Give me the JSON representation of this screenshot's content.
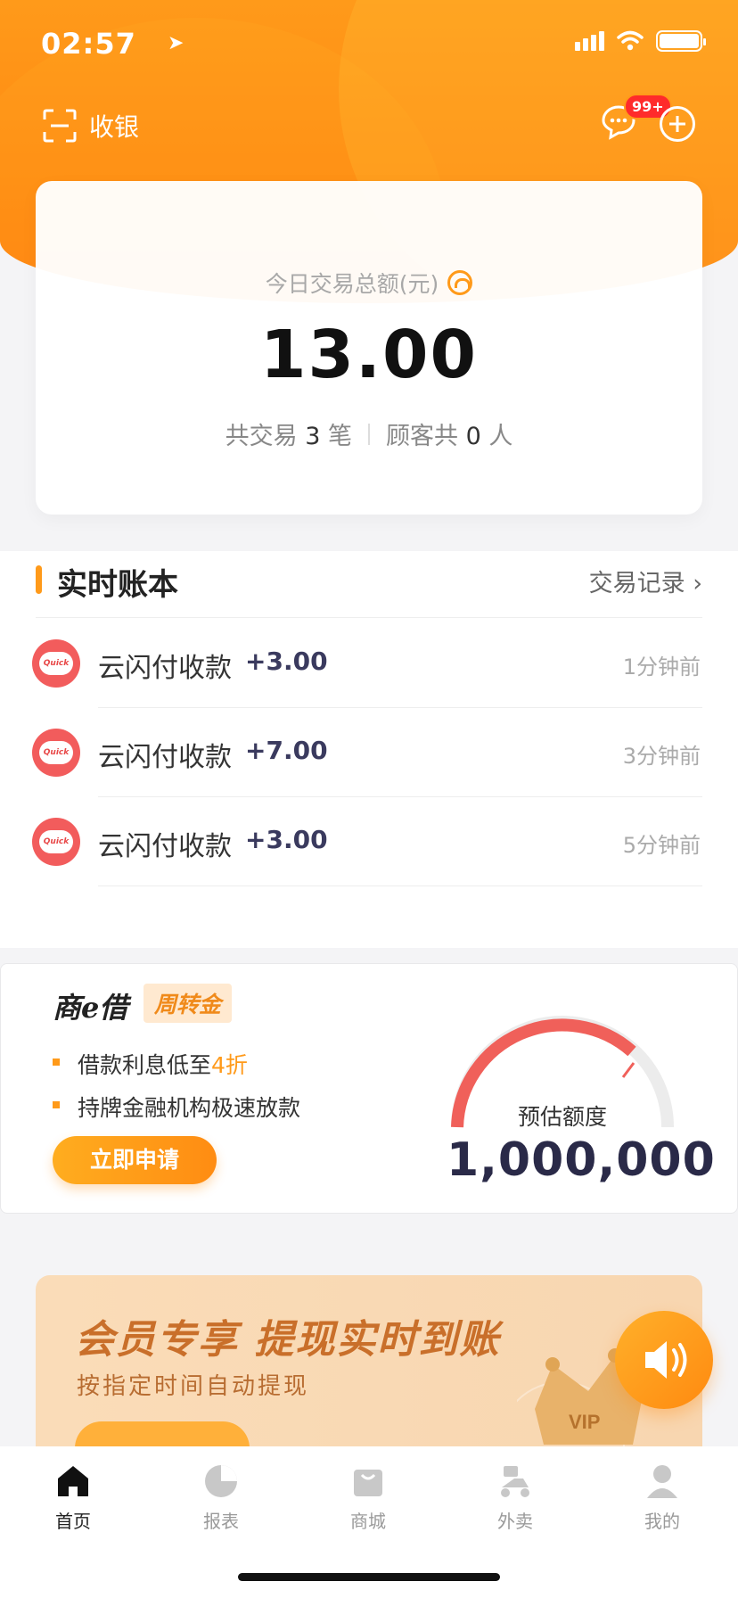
{
  "status": {
    "time": "02:57"
  },
  "header": {
    "scan_label": "收银",
    "message_badge": "99+"
  },
  "summary": {
    "label": "今日交易总额(元)",
    "amount": "13.00",
    "trades_prefix": "共交易",
    "trades_count": "3",
    "trades_suffix": "笔",
    "customers_prefix": "顾客共",
    "customers_count": "0",
    "customers_suffix": "人"
  },
  "ledger": {
    "title": "实时账本",
    "link": "交易记录 ›",
    "rows": [
      {
        "name": "云闪付收款",
        "amount": "+3.00",
        "time": "1分钟前"
      },
      {
        "name": "云闪付收款",
        "amount": "+7.00",
        "time": "3分钟前"
      },
      {
        "name": "云闪付收款",
        "amount": "+3.00",
        "time": "5分钟前"
      }
    ]
  },
  "loan": {
    "brand": "商e借",
    "tag": "周转金",
    "bullet1_text": "借款利息低至",
    "bullet1_highlight": "4折",
    "bullet2_text": "持牌金融机构极速放款",
    "apply_label": "立即申请",
    "estimate_label": "预估额度",
    "estimate_value": "1,000,000"
  },
  "promo": {
    "headline": "会员专享  提现实时到账",
    "subline": "按指定时间自动提现",
    "crown_text": "VIP"
  },
  "tabs": [
    {
      "label": "首页",
      "icon": "home-icon"
    },
    {
      "label": "报表",
      "icon": "pie-chart-icon"
    },
    {
      "label": "商城",
      "icon": "shopping-bag-icon"
    },
    {
      "label": "外卖",
      "icon": "scooter-icon"
    },
    {
      "label": "我的",
      "icon": "user-icon"
    }
  ],
  "colors": {
    "accent": "#ff9a1a",
    "badge": "#ff2b2b",
    "payment_icon": "#f25c5c"
  }
}
